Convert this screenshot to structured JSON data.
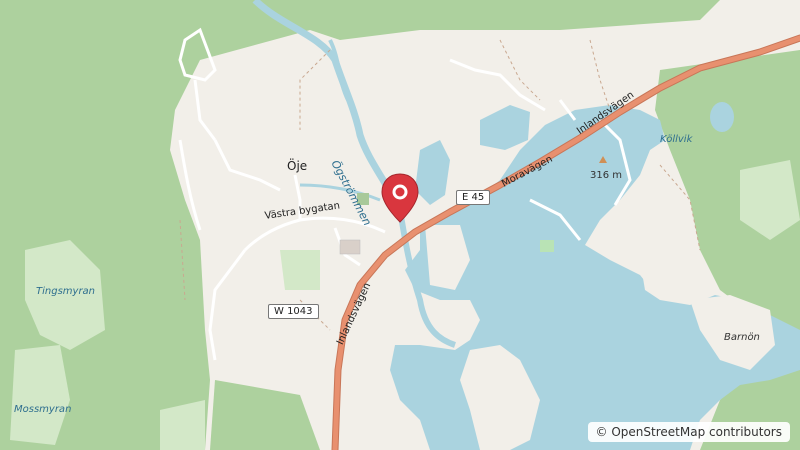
{
  "map": {
    "colors": {
      "land": "#f2efe9",
      "forest": "#add19e",
      "water": "#aad3df",
      "wetland": "#d3e8c8",
      "primary_road": "#e8906f",
      "minor_road": "#ffffff",
      "path": "#c9a890",
      "marker": "#d9363e"
    },
    "places": {
      "oje": "Öje",
      "kollvik": "Köllvik",
      "barnon": "Barnön",
      "tingsmyran": "Tingsmyran",
      "mossmyran": "Mossmyran",
      "ogstrommen": "Ögströmmen",
      "peak": "316 m"
    },
    "roads": {
      "vastra_bygatan": "Västra bygatan",
      "moravagen": "Moravägen",
      "inlandsvagen_ne": "Inlandsvägen",
      "inlandsvagen_sw": "Inlandsvägen",
      "e45_shield": "E 45",
      "w1043_shield": "W 1043"
    },
    "attribution": "© OpenStreetMap contributors",
    "icons": {
      "marker": "map-pin-icon",
      "peak": "peak-triangle-icon"
    }
  }
}
